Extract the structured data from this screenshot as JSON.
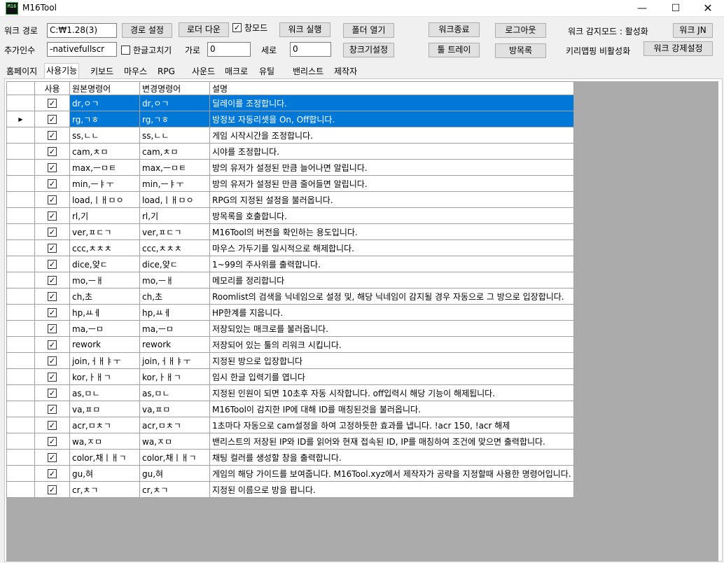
{
  "window": {
    "title": "M16Tool",
    "icon_text": "M16",
    "minimize_glyph": "—",
    "maximize_glyph": "☐",
    "close_glyph": "✕"
  },
  "toolbar": {
    "work_path_label": "워크 경로",
    "work_path_value": "C:₩1.28(3)",
    "set_path_button": "경로 설정",
    "loader_download_button": "로더 다운",
    "window_mode_label": "창모드",
    "window_mode_checked": true,
    "run_work_button": "워크 실행",
    "open_folder_button": "폴더 열기",
    "work_exit_button": "워크종료",
    "logout_button": "로그아웃",
    "detect_mode_label": "워크 감지모드 : 활성화",
    "work_jn_button": "워크 JN",
    "extra_args_label": "추가인수",
    "extra_args_value": "-nativefullscr",
    "hangul_fix_label": "한글고치기",
    "hangul_fix_checked": false,
    "width_label": "가로",
    "width_value": "0",
    "height_label": "세로",
    "height_value": "0",
    "window_settings_button": "창크기설정",
    "tool_tray_button": "툴 트레이",
    "room_list_button": "방목록",
    "keymap_label": "키리맵핑 비활성화",
    "force_settings_button": "워크 강제설정"
  },
  "tabs": [
    {
      "label": "홈페이지",
      "active": false
    },
    {
      "label": "사용기능",
      "active": true
    },
    {
      "label": "키보드",
      "active": false
    },
    {
      "label": "마우스",
      "active": false
    },
    {
      "label": "RPG",
      "active": false
    },
    {
      "label": "사운드",
      "active": false
    },
    {
      "label": "매크로",
      "active": false
    },
    {
      "label": "유틸",
      "active": false
    },
    {
      "label": "밴리스트",
      "active": false
    },
    {
      "label": "제작자",
      "active": false
    }
  ],
  "grid": {
    "columns": [
      "사용",
      "원본명령어",
      "변경명령어",
      "설명"
    ],
    "check_glyph": "✓",
    "current_row_glyph": "▶",
    "current_row": 1,
    "rows": [
      {
        "use": true,
        "orig": "dr,ㅇㄱ",
        "changed": "dr,ㅇㄱ",
        "desc": "딜레이를 조정합니다.",
        "selected": true
      },
      {
        "use": true,
        "orig": "rg,ㄱㅎ",
        "changed": "rg,ㄱㅎ",
        "desc": "방정보 자동리셋을 On, Off합니다.",
        "selected": true
      },
      {
        "use": true,
        "orig": "ss,ㄴㄴ",
        "changed": "ss,ㄴㄴ",
        "desc": "게임 시작시간을 조정합니다.",
        "selected": false
      },
      {
        "use": true,
        "orig": "cam,ㅊㅁ",
        "changed": "cam,ㅊㅁ",
        "desc": "시야를 조정합니다.",
        "selected": false
      },
      {
        "use": true,
        "orig": "max,ㅡㅁㅌ",
        "changed": "max,ㅡㅁㅌ",
        "desc": "방의 유저가 설정된 만큼 늘어나면 알립니다.",
        "selected": false
      },
      {
        "use": true,
        "orig": "min,ㅡㅑㅜ",
        "changed": "min,ㅡㅑㅜ",
        "desc": "방의 유저가 설정된 만큼 줄어들면 알립니다.",
        "selected": false
      },
      {
        "use": true,
        "orig": "load,ㅣㅐㅁㅇ",
        "changed": "load,ㅣㅐㅁㅇ",
        "desc": "RPG의 지정된 설정을 불러옵니다.",
        "selected": false
      },
      {
        "use": true,
        "orig": "rl,기",
        "changed": "rl,기",
        "desc": "방목록을 호출합니다.",
        "selected": false
      },
      {
        "use": true,
        "orig": "ver,ㅍㄷㄱ",
        "changed": "ver,ㅍㄷㄱ",
        "desc": "M16Tool의 버전을 확인하는 용도입니다.",
        "selected": false
      },
      {
        "use": true,
        "orig": "ccc,ㅊㅊㅊ",
        "changed": "ccc,ㅊㅊㅊ",
        "desc": "마우스 가두기를 일시적으로 해제합니다.",
        "selected": false
      },
      {
        "use": true,
        "orig": "dice,얒ㄷ",
        "changed": "dice,얒ㄷ",
        "desc": "1~99의 주사위를 출력합니다.",
        "selected": false
      },
      {
        "use": true,
        "orig": "mo,ㅡㅐ",
        "changed": "mo,ㅡㅐ",
        "desc": "메모리를 정리합니다",
        "selected": false
      },
      {
        "use": true,
        "orig": "ch,초",
        "changed": "ch,초",
        "desc": "Roomlist의 검색을 닉네임으로 설정 및, 해당 닉네임이 감지될 경우 자동으로 그 방으로 입장합니다.",
        "selected": false
      },
      {
        "use": true,
        "orig": "hp,ㅛㅔ",
        "changed": "hp,ㅛㅔ",
        "desc": "HP한계를 지웁니다.",
        "selected": false
      },
      {
        "use": true,
        "orig": "ma,ㅡㅁ",
        "changed": "ma,ㅡㅁ",
        "desc": "저장되있는 매크로를 불러옵니다.",
        "selected": false
      },
      {
        "use": true,
        "orig": "rework",
        "changed": "rework",
        "desc": "저장되어 있는 툴의 리워크 시킵니다.",
        "selected": false
      },
      {
        "use": true,
        "orig": "join,ㅓㅐㅑㅜ",
        "changed": "join,ㅓㅐㅑㅜ",
        "desc": "지정된 방으로 입장합니다",
        "selected": false
      },
      {
        "use": true,
        "orig": "kor,ㅏㅐㄱ",
        "changed": "kor,ㅏㅐㄱ",
        "desc": "임시 한글 입력기를 엽니다",
        "selected": false
      },
      {
        "use": true,
        "orig": "as,ㅁㄴ",
        "changed": "as,ㅁㄴ",
        "desc": "지정된 인원이 되면 10초후 자동 시작합니다. off입력시 해당 기능이 해제됩니다.",
        "selected": false
      },
      {
        "use": true,
        "orig": "va,ㅍㅁ",
        "changed": "va,ㅍㅁ",
        "desc": "M16Tool이 감지한 IP에 대해 ID를 매칭된것을 불러옵니다.",
        "selected": false
      },
      {
        "use": true,
        "orig": "acr,ㅁㅊㄱ",
        "changed": "acr,ㅁㅊㄱ",
        "desc": "1초마다 자동으로 cam설정을 하여 고정하듯한 효과를 냅니다. !acr 150, !acr 해제",
        "selected": false
      },
      {
        "use": true,
        "orig": "wa,ㅈㅁ",
        "changed": "wa,ㅈㅁ",
        "desc": "밴리스트의 저장된 IP와 ID를 읽어와 현재 접속된 ID, IP를 매칭하여 조건에 맞으면 출력합니다.",
        "selected": false
      },
      {
        "use": true,
        "orig": "color,채ㅣㅐㄱ",
        "changed": "color,채ㅣㅐㄱ",
        "desc": "채팅 컬러를 생성할 창을 출력합니다.",
        "selected": false
      },
      {
        "use": true,
        "orig": "gu,혀",
        "changed": "gu,혀",
        "desc": "게임의 해당 가이드를 보여줍니다. M16Tool.xyz에서 제작자가 공략을 지정할때 사용한 명령어입니다.",
        "selected": false
      },
      {
        "use": true,
        "orig": "cr,ㅊㄱ",
        "changed": "cr,ㅊㄱ",
        "desc": "지정된 이름으로 방을 팝니다.",
        "selected": false
      }
    ]
  },
  "colors": {
    "selection": "#0078d7",
    "grid_background": "#ababab",
    "window_background": "#f0f0f0"
  }
}
